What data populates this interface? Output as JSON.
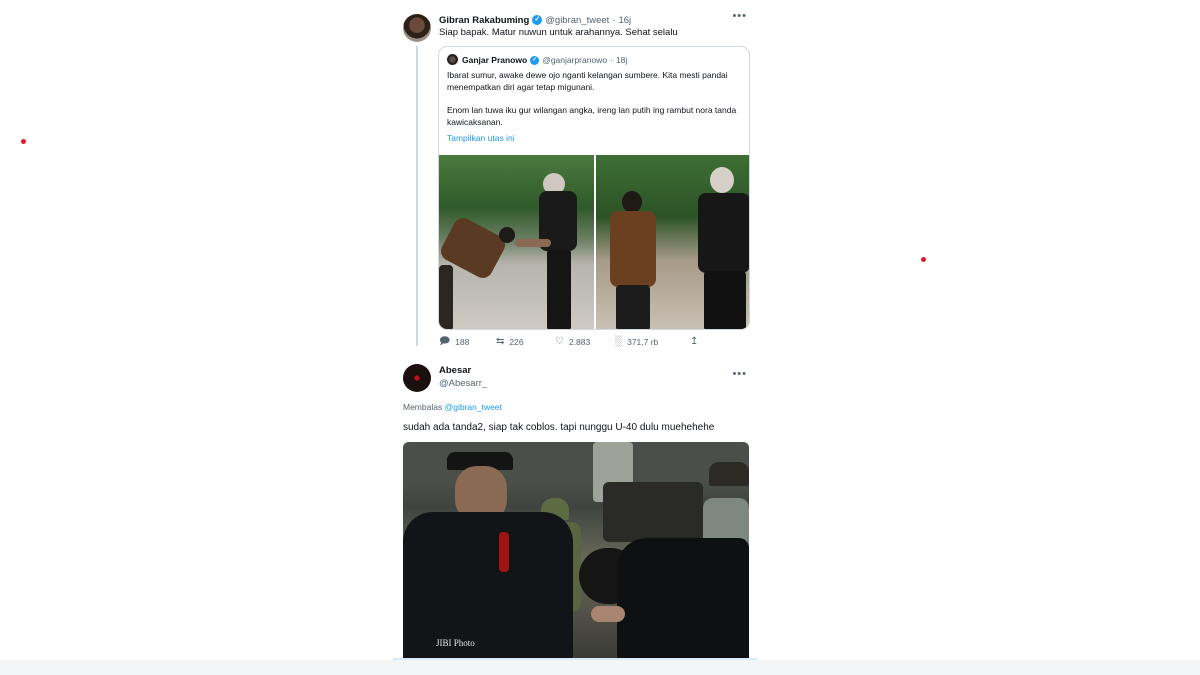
{
  "tweet1": {
    "author_name": "Gibran Rakabuming",
    "verified": true,
    "handle": "@gibran_tweet",
    "time": "16j",
    "text": "Siap bapak. Matur nuwun untuk arahannya. Sehat selalu",
    "more_icon": "more-horizontal-icon",
    "quote": {
      "author_name": "Ganjar Pranowo",
      "verified": true,
      "handle": "@ganjarpranowo",
      "time": "18j",
      "paragraph1": "Ibarat sumur, awake dewe ojo nganti kelangan sumbere. Kita mesti pandai menempatkan diri agar tetap migunani.",
      "paragraph2": "Enom lan tuwa iku gur wilangan angka, ireng lan putih ing rambut nora tanda kawicaksanan.",
      "show_thread": "Tampilkan utas ini"
    },
    "actions": {
      "replies": "188",
      "retweets": "226",
      "likes": "2.883",
      "views": "371,7 rb"
    }
  },
  "tweet2": {
    "author_name": "Abesar",
    "handle": "@Abesarr_",
    "replying_prefix": "Membalas",
    "replying_to": "@gibran_tweet",
    "text": "sudah ada tanda2, siap tak coblos.  tapi nunggu U-40 dulu muehehehe",
    "photo_credit": "JIBI Photo"
  },
  "colors": {
    "accent": "#1d9bf0",
    "text": "#0f1419",
    "muted": "#536471",
    "border": "#cfd9de"
  }
}
